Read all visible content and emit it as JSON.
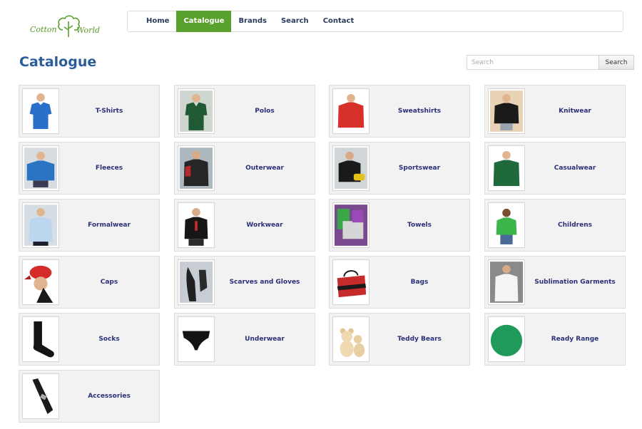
{
  "brand": {
    "logo_text_left": "Cotton",
    "logo_text_right": "World",
    "green": "#5aa02c",
    "blue": "#2b5d9b"
  },
  "nav": {
    "items": [
      {
        "label": "Home",
        "active": false
      },
      {
        "label": "Catalogue",
        "active": true
      },
      {
        "label": "Brands",
        "active": false
      },
      {
        "label": "Search",
        "active": false
      },
      {
        "label": "Contact",
        "active": false
      }
    ]
  },
  "page": {
    "title": "Catalogue"
  },
  "search": {
    "placeholder": "Search",
    "button_label": "Search"
  },
  "categories": [
    {
      "label": "T-Shirts",
      "icon": "tshirt-icon"
    },
    {
      "label": "Polos",
      "icon": "polo-icon"
    },
    {
      "label": "Sweatshirts",
      "icon": "sweatshirt-icon"
    },
    {
      "label": "Knitwear",
      "icon": "knitwear-icon"
    },
    {
      "label": "Fleeces",
      "icon": "fleece-icon"
    },
    {
      "label": "Outerwear",
      "icon": "outerwear-icon"
    },
    {
      "label": "Sportswear",
      "icon": "sportswear-icon"
    },
    {
      "label": "Casualwear",
      "icon": "casualwear-icon"
    },
    {
      "label": "Formalwear",
      "icon": "formalwear-icon"
    },
    {
      "label": "Workwear",
      "icon": "workwear-icon"
    },
    {
      "label": "Towels",
      "icon": "towels-icon"
    },
    {
      "label": "Childrens",
      "icon": "childrens-icon"
    },
    {
      "label": "Caps",
      "icon": "cap-icon"
    },
    {
      "label": "Scarves and Gloves",
      "icon": "gloves-icon"
    },
    {
      "label": "Bags",
      "icon": "bag-icon"
    },
    {
      "label": "Sublimation Garments",
      "icon": "sublimation-icon"
    },
    {
      "label": "Socks",
      "icon": "sock-icon"
    },
    {
      "label": "Underwear",
      "icon": "underwear-icon"
    },
    {
      "label": "Teddy Bears",
      "icon": "teddy-bear-icon"
    },
    {
      "label": "Ready Range",
      "icon": "frisbee-icon"
    },
    {
      "label": "Accessories",
      "icon": "accessory-icon"
    }
  ]
}
